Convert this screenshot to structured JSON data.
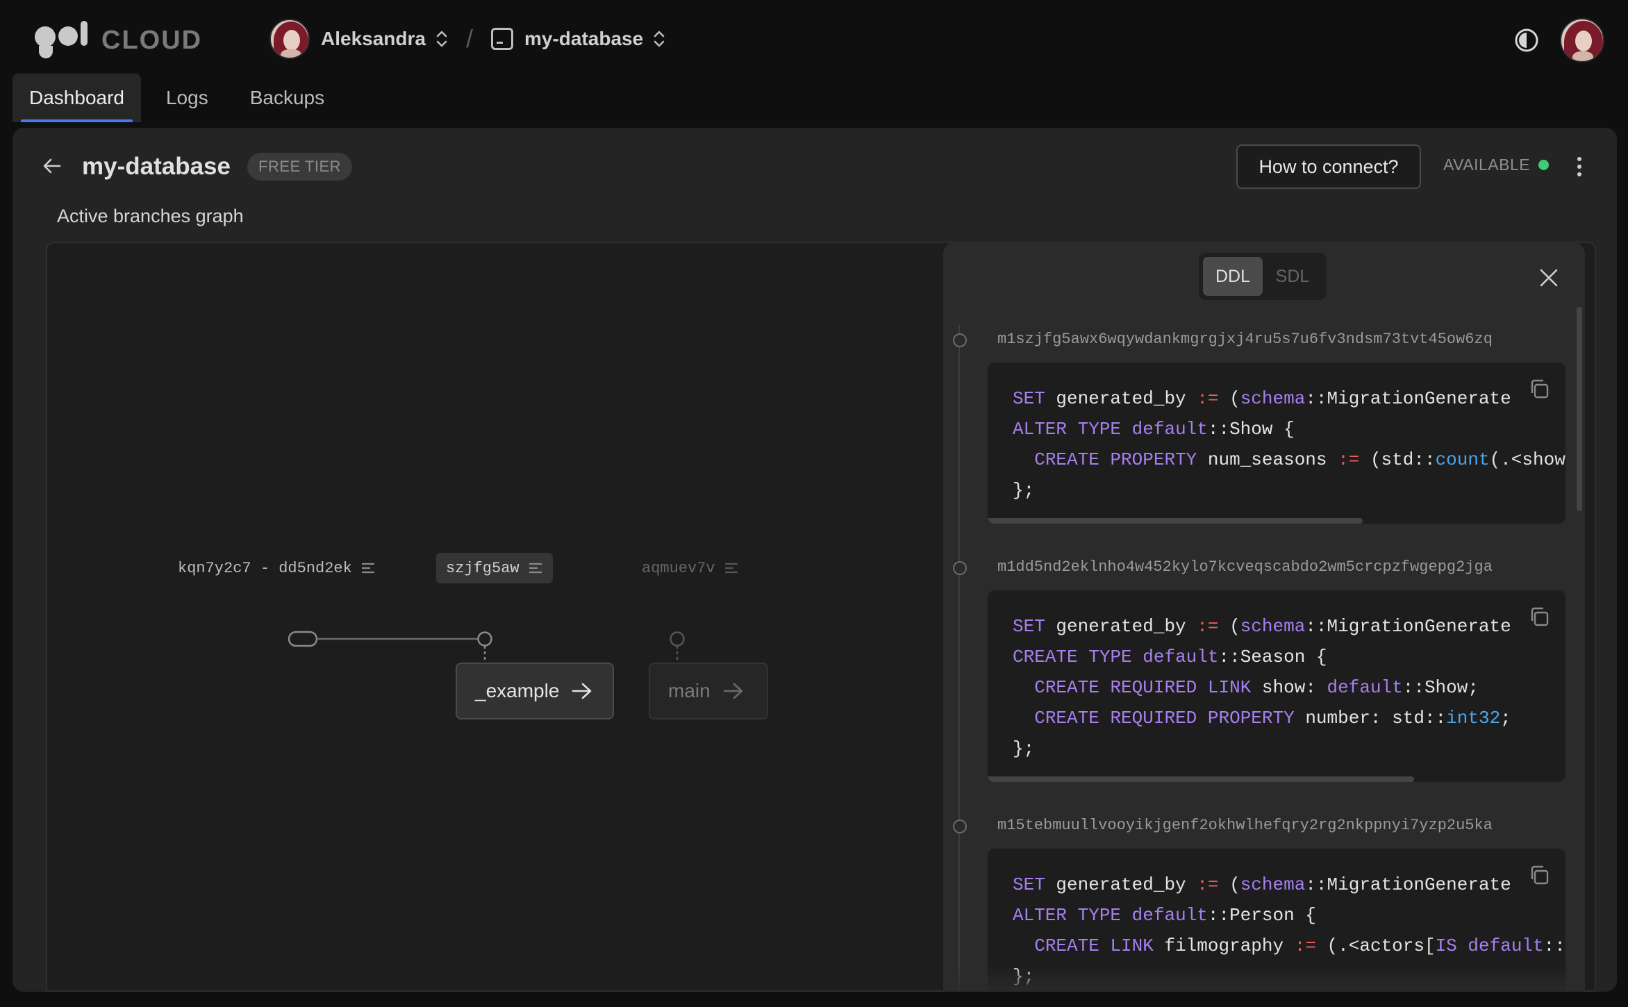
{
  "brand": {
    "name": "CLOUD"
  },
  "breadcrumbs": {
    "org": "Aleksandra",
    "separator": "/",
    "database": "my-database"
  },
  "nav": {
    "tabs": [
      {
        "label": "Dashboard",
        "active": true
      },
      {
        "label": "Logs",
        "active": false
      },
      {
        "label": "Backups",
        "active": false
      }
    ]
  },
  "database": {
    "name": "my-database",
    "tier": "FREE TIER",
    "connect_label": "How to connect?",
    "status": "AVAILABLE",
    "status_color": "#3fcb72"
  },
  "graph": {
    "title": "Active branches graph",
    "branch_labels": [
      "kqn7y2c7 - dd5nd2ek",
      "szjfg5aw",
      "aqmuev7v"
    ],
    "branches": [
      {
        "name": "_example"
      },
      {
        "name": "main"
      }
    ]
  },
  "schema_panel": {
    "modes": [
      "DDL",
      "SDL"
    ],
    "active_mode": "DDL",
    "migrations": [
      {
        "id": "m1szjfg5awx6wqywdankmgrgjxj4ru5s7u6fv3ndsm73tvt45ow6zq"
      },
      {
        "id": "m1dd5nd2eklnho4w452kylo7kcveqscabdo2wm5crcpzfwgepg2jga"
      },
      {
        "id": "m15tebmuullvooyikjgenf2okhwlhefqry2rg2nkppnyi7yzp2u5ka"
      }
    ]
  },
  "icons": {
    "theme": "theme-toggle-icon",
    "back": "arrow-left-icon",
    "more": "kebab-menu-icon",
    "close": "close-icon",
    "copy": "copy-icon",
    "branch_menu": "lines-menu-icon",
    "go": "arrow-right-icon"
  },
  "colors": {
    "accent": "#4a78e8",
    "keyword": "#a77ff0",
    "operator": "#ef5a5a",
    "function": "#4aa7ea"
  }
}
